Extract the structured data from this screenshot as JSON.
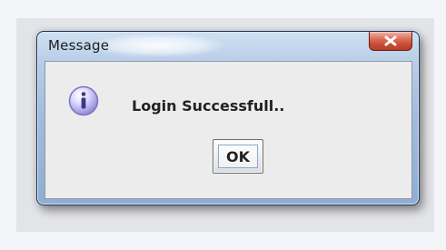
{
  "dialog": {
    "title": "Message",
    "message": "Login Successfull..",
    "ok_label": "OK",
    "icon": "information-icon",
    "close_icon": "close-icon"
  }
}
